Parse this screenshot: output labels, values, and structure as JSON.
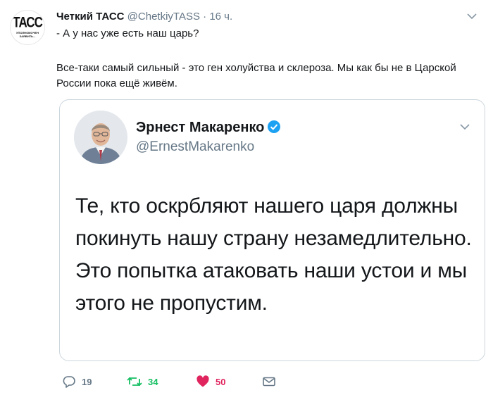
{
  "tweet": {
    "avatar_logo": "ТАСС",
    "avatar_subtitle": "УПОЛНОМОЧЕН ЗАЯВИТЬ...",
    "author_name": "Четкий ТАСС",
    "author_handle": "@ChetkiyTASS",
    "separator": "·",
    "time": "16 ч.",
    "reply_line": "- А у нас уже есть наш царь?",
    "text": "Все-таки самый сильный - это ген холуйства и склероза. Мы как бы не в Царской России пока ещё живём."
  },
  "quote": {
    "author_name": "Эрнест Макаренко",
    "author_handle": "@ErnestMakarenko",
    "text": "Те, кто оскрбляют нашего царя должны покинуть нашу страну незамедлительно. Это попытка атаковать наши устои и мы этого не пропустим."
  },
  "actions": {
    "replies": "19",
    "retweets": "34",
    "likes": "50"
  },
  "colors": {
    "retweet": "#17bf63",
    "like": "#e0245e",
    "verified": "#1da1f2",
    "muted": "#657786"
  },
  "icons": [
    "reply-icon",
    "retweet-icon",
    "heart-icon",
    "envelope-icon",
    "verified-badge-icon",
    "chevron-down-icon"
  ]
}
